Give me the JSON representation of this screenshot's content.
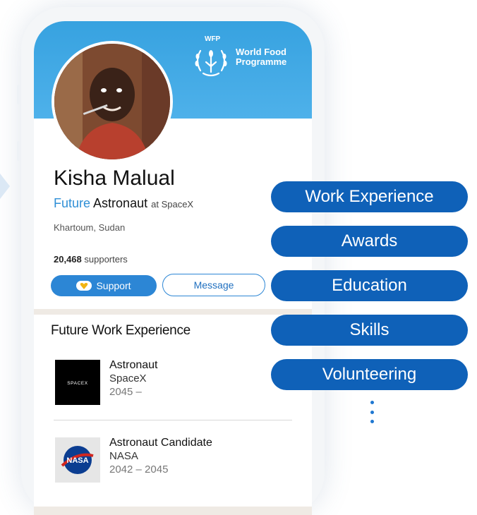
{
  "profile": {
    "name": "Kisha Malual",
    "title_future": "Future",
    "title_role": "Astronaut",
    "title_at": "at SpaceX",
    "location": "Khartoum, Sudan",
    "supporters_count": "20,468",
    "supporters_label": "supporters"
  },
  "header": {
    "logo_tag": "WFP",
    "logo_line1": "World Food",
    "logo_line2": "Programme"
  },
  "actions": {
    "support_label": "Support",
    "message_label": "Message"
  },
  "experience": {
    "section_title": "Future Work Experience",
    "items": [
      {
        "role": "Astronaut",
        "org": "SpaceX",
        "dates": "2045 –",
        "logo_text": "SPACEX"
      },
      {
        "role": "Astronaut Candidate",
        "org": "NASA",
        "dates": "2042 – 2045",
        "logo_text": "NASA"
      }
    ]
  },
  "sections_menu": [
    {
      "label": "Work Experience"
    },
    {
      "label": "Awards"
    },
    {
      "label": "Education"
    },
    {
      "label": "Skills"
    },
    {
      "label": "Volunteering"
    }
  ],
  "colors": {
    "header_blue": "#4eb1ea",
    "pill_blue": "#0f61b8",
    "support_blue": "#2c86d5"
  },
  "icons": [
    "wfp-emblem-icon",
    "heart-icon",
    "more-vertical-icon"
  ]
}
